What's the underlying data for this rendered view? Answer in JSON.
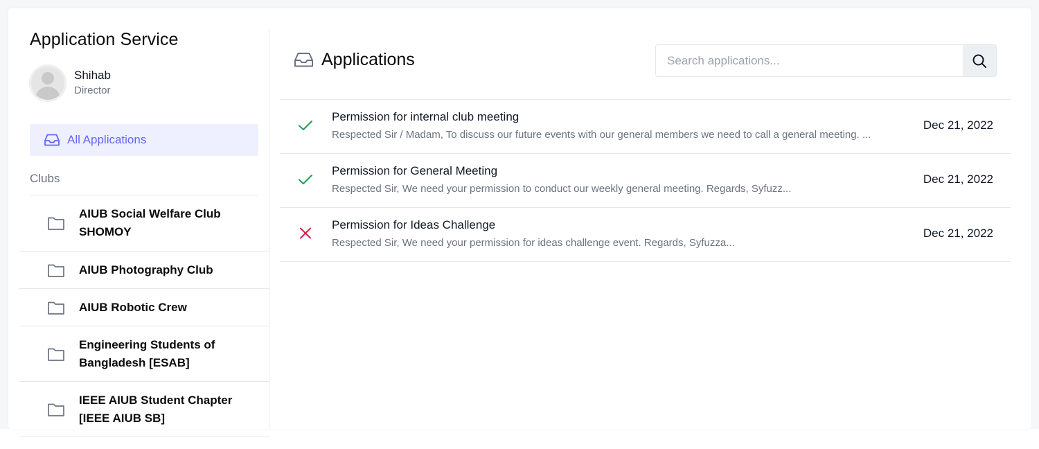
{
  "sidebar": {
    "title": "Application Service",
    "user": {
      "name": "Shihab",
      "role": "Director"
    },
    "nav_all_label": "All Applications",
    "clubs_heading": "Clubs",
    "clubs": [
      {
        "line1": "AIUB Social Welfare Club",
        "line2": "SHOMOY"
      },
      {
        "line1": "AIUB Photography Club",
        "line2": ""
      },
      {
        "line1": "AIUB Robotic Crew",
        "line2": ""
      },
      {
        "line1": "Engineering Students of",
        "line2": "Bangladesh [ESAB]"
      },
      {
        "line1": "IEEE AIUB Student Chapter",
        "line2": "[IEEE AIUB SB]"
      }
    ]
  },
  "main": {
    "title": "Applications",
    "search": {
      "placeholder": "Search applications...",
      "value": ""
    },
    "applications": [
      {
        "status": "approved",
        "subject": "Permission for internal club meeting",
        "preview": "Respected Sir / Madam, To discuss our future events with our general members we need to call a general meeting. ...",
        "date": "Dec 21, 2022"
      },
      {
        "status": "approved",
        "subject": "Permission for General Meeting",
        "preview": "Respected Sir, We need your permission to conduct our weekly general meeting. Regards, Syfuzz...",
        "date": "Dec 21, 2022"
      },
      {
        "status": "rejected",
        "subject": "Permission for Ideas Challenge",
        "preview": "Respected Sir, We need your permission for ideas challenge event. Regards, Syfuzza...",
        "date": "Dec 21, 2022"
      }
    ]
  },
  "colors": {
    "accent": "#6366f1",
    "accent_bg": "#eef0ff",
    "approved": "#16a34a",
    "rejected": "#e11d48",
    "muted_text": "#6b7280",
    "icon_gray": "#6b7280"
  },
  "icons": {
    "nav_all": "inbox-icon",
    "title": "inbox-icon",
    "search": "search-icon",
    "club": "folder-icon",
    "approved": "check-icon",
    "rejected": "x-icon"
  }
}
